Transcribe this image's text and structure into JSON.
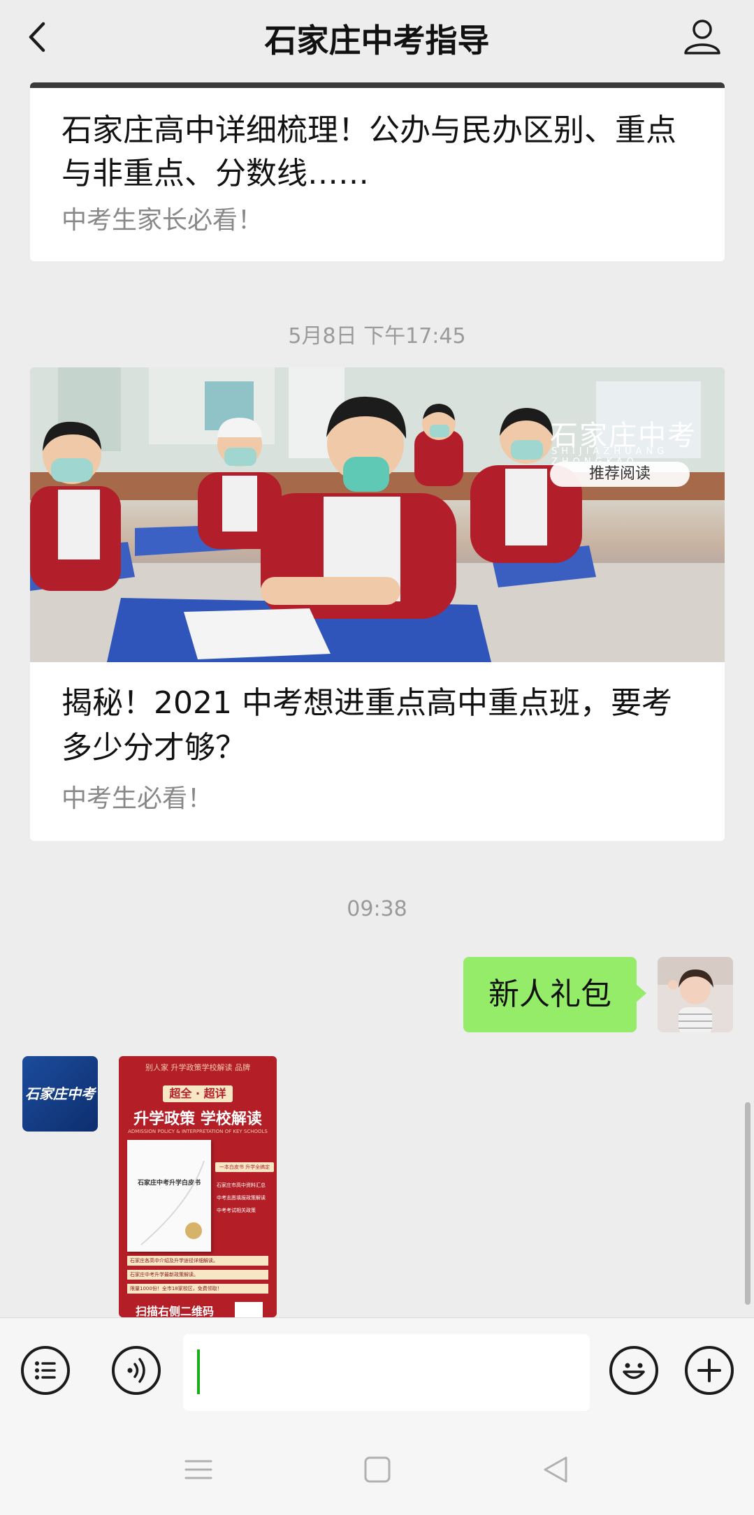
{
  "header": {
    "title": "石家庄中考指导"
  },
  "articles": [
    {
      "title_line1": "石家庄高中详细梳理！公办与民办区别、重点",
      "title_line2": "与非重点、分数线……",
      "subtitle": "中考生家长必看！"
    },
    {
      "title_line1": "揭秘！2021 中考想进重点高中重点班，要考",
      "title_line2": "多少分才够？",
      "subtitle": "中考生必看！",
      "image": {
        "brand": "石家庄中考",
        "brand_pinyin": "SHIJIAZHUANG ZHONGKAO",
        "badge": "推荐阅读"
      }
    }
  ],
  "timestamps": {
    "t1": "5月8日 下午17:45",
    "t2": "09:38"
  },
  "messages": {
    "me_text": "新人礼包",
    "brand_avatar_text": "石家庄中考",
    "poster": {
      "top_text": "别人家 升学政策学校解读 品牌",
      "tag": "超全 · 超详",
      "headline": "升学政策 学校解读",
      "subline": "ADMISSION POLICY & INTERPRETATION OF KEY SCHOOLS",
      "book_title": "石家庄中考升学白皮书",
      "side_tag": "一本白皮书 升学全搞定",
      "side_items": [
        "石家庄市高中资料汇总",
        "中考志愿填报政策解读",
        "中考考试相关政策"
      ],
      "bullets": [
        "石家庄各高中介绍及升学途径详细解读。",
        "石家庄中考升学最新政策解读。",
        "限量1000份！全市18家校区，免费领取！"
      ],
      "bottom_text": "扫描右侧二维码"
    }
  },
  "icons": [
    "back-icon",
    "user-icon",
    "menu-list-icon",
    "voice-icon",
    "emoji-icon",
    "plus-icon",
    "nav-menu-icon",
    "nav-home-icon",
    "nav-back-icon"
  ],
  "colors": {
    "bubble": "#95ec69",
    "caret": "#1aad19",
    "poster_red": "#b41f27",
    "brand_blue": "#1c4c9c"
  }
}
